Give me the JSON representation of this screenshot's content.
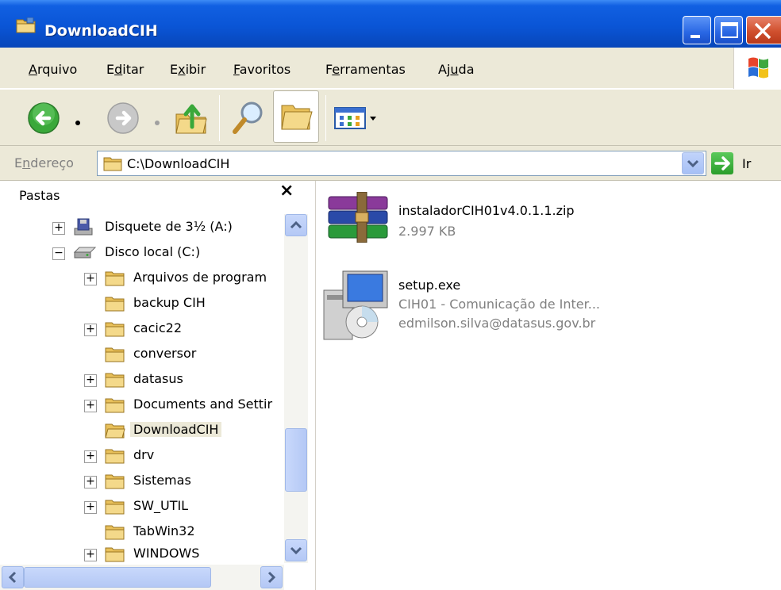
{
  "window": {
    "title": "DownloadCIH"
  },
  "menu": {
    "items": [
      {
        "pre": "",
        "ul": "A",
        "post": "rquivo"
      },
      {
        "pre": "E",
        "ul": "d",
        "post": "itar"
      },
      {
        "pre": "E",
        "ul": "x",
        "post": "ibir"
      },
      {
        "pre": "",
        "ul": "F",
        "post": "avoritos"
      },
      {
        "pre": "F",
        "ul": "e",
        "post": "rramentas"
      },
      {
        "pre": "Aj",
        "ul": "u",
        "post": "da"
      }
    ]
  },
  "address": {
    "label_pre": "E",
    "label_ul": "n",
    "label_post": "dereço",
    "path": "C:\\DownloadCIH",
    "go_label": "Ir"
  },
  "folders": {
    "header": "Pastas",
    "close": "×",
    "tree": [
      {
        "label": "Disquete de 3½ (A:)",
        "expander": "+"
      },
      {
        "label": "Disco local (C:)",
        "expander": "−"
      },
      {
        "label": "Arquivos de program",
        "expander": "+"
      },
      {
        "label": "backup CIH",
        "expander": ""
      },
      {
        "label": "cacic22",
        "expander": "+"
      },
      {
        "label": "conversor",
        "expander": ""
      },
      {
        "label": "datasus",
        "expander": "+"
      },
      {
        "label": "Documents and Settir",
        "expander": "+"
      },
      {
        "label": "DownloadCIH",
        "expander": "",
        "selected": true
      },
      {
        "label": "drv",
        "expander": "+"
      },
      {
        "label": "Sistemas",
        "expander": "+"
      },
      {
        "label": "SW_UTIL",
        "expander": "+"
      },
      {
        "label": "TabWin32",
        "expander": ""
      },
      {
        "label": "WINDOWS",
        "expander": "+"
      }
    ]
  },
  "files": [
    {
      "name": "instaladorCIH01v4.0.1.1.zip",
      "line2": "2.997 KB",
      "line3": "",
      "icon": "winrar-archive-icon"
    },
    {
      "name": "setup.exe",
      "line2": "CIH01 - Comunicação de Inter...",
      "line3": "edmilson.silva@datasus.gov.br",
      "icon": "installer-icon"
    }
  ]
}
